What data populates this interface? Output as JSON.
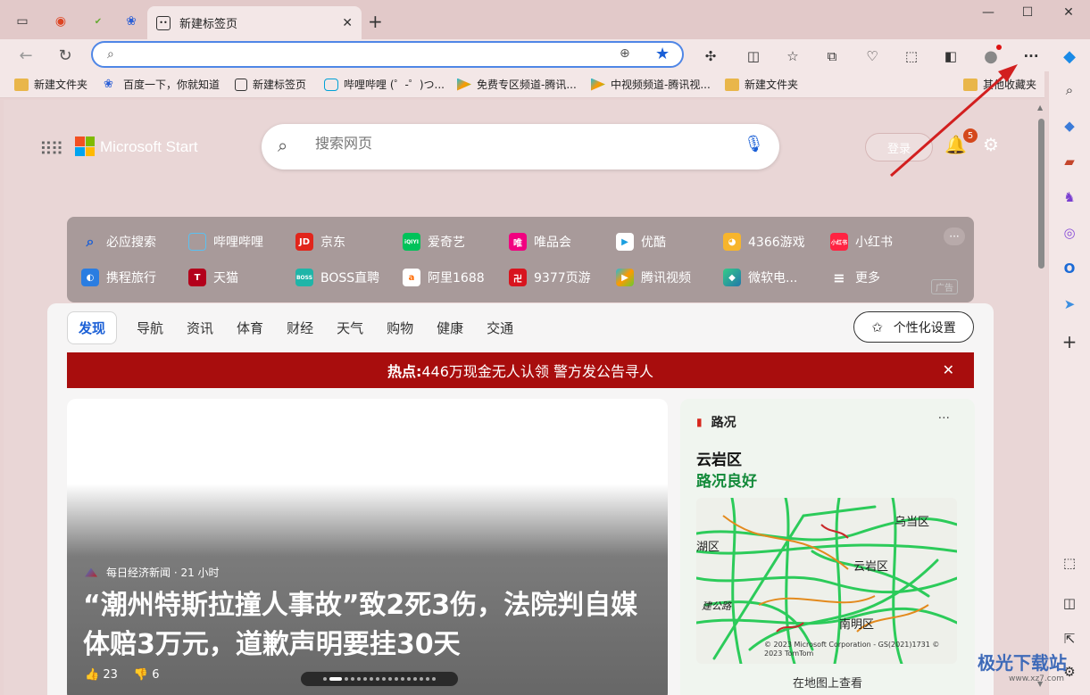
{
  "browser": {
    "active_tab_title": "新建标签页",
    "address_value": "",
    "bookmarks": [
      {
        "label": "新建文件夹",
        "icon": "folder-icon"
      },
      {
        "label": "百度一下，你就知道",
        "icon": "baidu-icon"
      },
      {
        "label": "新建标签页",
        "icon": "newtab-icon"
      },
      {
        "label": "哔哩哔哩 (゜-゜)つ...",
        "icon": "bilibili-icon"
      },
      {
        "label": "免费专区频道-腾讯...",
        "icon": "tencent-video-icon"
      },
      {
        "label": "中视频频道-腾讯视...",
        "icon": "tencent-video-icon"
      },
      {
        "label": "新建文件夹",
        "icon": "folder-icon"
      }
    ],
    "other_bookmarks": "其他收藏夹"
  },
  "newtab": {
    "brand": "Microsoft Start",
    "search_placeholder": "搜索网页",
    "login": "登录",
    "notification_count": "5",
    "quick_links_row1": [
      "必应搜索",
      "哔哩哔哩",
      "京东",
      "爱奇艺",
      "唯品会",
      "优酷",
      "4366游戏",
      "小红书"
    ],
    "quick_links_row2": [
      "携程旅行",
      "天猫",
      "BOSS直聘",
      "阿里1688",
      "9377页游",
      "腾讯视频",
      "微软电...",
      "更多"
    ],
    "ad_label": "广告",
    "nav_tabs": [
      "发现",
      "导航",
      "资讯",
      "体育",
      "财经",
      "天气",
      "购物",
      "健康",
      "交通"
    ],
    "personalize": "个性化设置",
    "hot_label": "热点:",
    "hot_text": "446万现金无人认领 警方发公告寻人",
    "article": {
      "source": "每日经济新闻 · 21 小时",
      "headline": "“潮州特斯拉撞人事故”致2死3伤，法院判自媒体赔3万元，道歉声明要挂30天",
      "likes": "23",
      "dislikes": "6"
    },
    "traffic": {
      "title": "路况",
      "district": "云岩区",
      "status": "路况良好",
      "map_labels": [
        "乌当区",
        "湖区",
        "云岩区",
        "南明区",
        "建公路"
      ],
      "map_copyright": "© 2023 Microsoft Corporation - GS(2021)1731 © 2023 TomTom",
      "view_on_map": "在地图上查看"
    }
  },
  "watermark": {
    "text": "极光下载站",
    "url_text": "www.xz7.com"
  },
  "colors": {
    "accent": "#1a5fd6",
    "hotbar": "#a80d0d",
    "traffic_good": "#138a3a"
  }
}
